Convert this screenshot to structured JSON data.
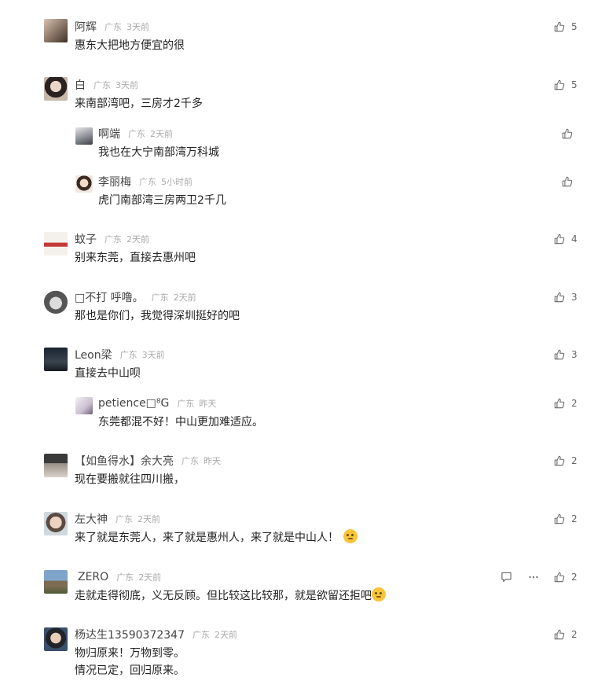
{
  "comments": [
    {
      "name": "阿辉",
      "region": "广东",
      "time": "3天前",
      "text": "惠东大把地方便宜的很",
      "likes": "5"
    },
    {
      "name": "白",
      "region": "广东",
      "time": "3天前",
      "text": "来南部湾吧，三房才2千多",
      "likes": "5"
    },
    {
      "name": "啊端",
      "region": "广东",
      "time": "2天前",
      "text": "我也在大宁南部湾万科城",
      "likes": ""
    },
    {
      "name": "李丽梅",
      "region": "广东",
      "time": "5小时前",
      "text": "虎门南部湾三房两卫2千几",
      "likes": ""
    },
    {
      "name": "蚊子",
      "region": "广东",
      "time": "2天前",
      "text": "别来东莞，直接去惠州吧",
      "likes": "4"
    },
    {
      "name": "□不打  呼噜。",
      "region": "广东",
      "time": "2天前",
      "text": "那也是你们，我觉得深圳挺好的吧",
      "likes": "3"
    },
    {
      "name": "Leon梁",
      "region": "广东",
      "time": "3天前",
      "text": "直接去中山呗",
      "likes": "3"
    },
    {
      "name": "petience□⁸G",
      "region": "广东",
      "time": "昨天",
      "text": "东莞都混不好！中山更加难适应。",
      "likes": "2"
    },
    {
      "name": "【如鱼得水】余大亮",
      "region": "广东",
      "time": "昨天",
      "text": "现在要搬就往四川搬，",
      "likes": "2"
    },
    {
      "name": "左大神",
      "region": "广东",
      "time": "2天前",
      "text": "来了就是东莞人，来了就是惠州人，来了就是中山人！",
      "likes": "2"
    },
    {
      "name": "ZERO",
      "region": "广东",
      "time": "2天前",
      "text": "走就走得彻底，义无反顾。但比较这比较那，就是欲留还拒吧",
      "likes": "2"
    },
    {
      "name": "杨达生13590372347",
      "region": "广东",
      "time": "2天前",
      "text": "物归原来！万物到零。",
      "text2": "情况已定，回归原来。",
      "likes": "2"
    }
  ],
  "colors": {
    "accent": "#1a73e8",
    "muted": "#aaaaaa"
  },
  "icons": {
    "like": "thumbs-up-icon",
    "reply": "comment-icon",
    "more": "more-dots-icon"
  }
}
